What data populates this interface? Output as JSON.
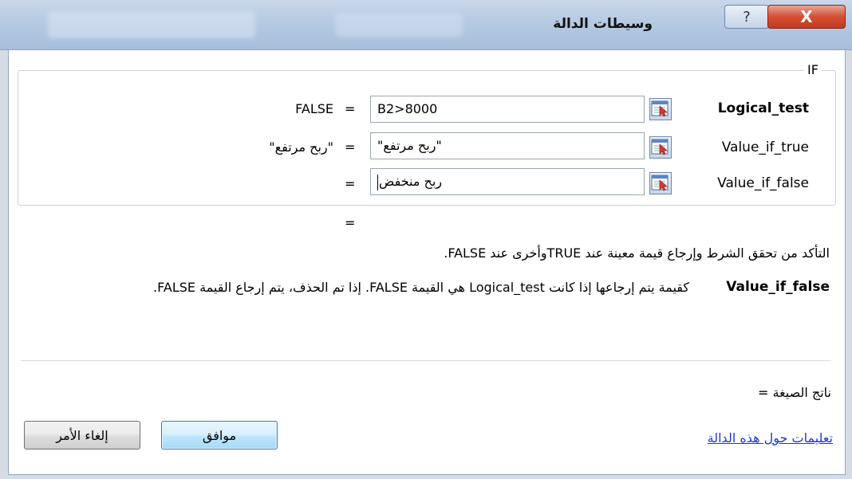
{
  "window": {
    "title": "وسيطات الدالة",
    "help_glyph": "?",
    "close_glyph": "X"
  },
  "function_name": "IF",
  "args": [
    {
      "name": "Logical_test",
      "value": "B2>8000",
      "eq": "=",
      "result": "FALSE"
    },
    {
      "name": "Value_if_true",
      "value": "\"ربح مرتفع\"",
      "eq": "=",
      "result": "\"ربح مرتفع\""
    },
    {
      "name": "Value_if_false",
      "value": "ربح منخفض",
      "eq": "=",
      "result": ""
    }
  ],
  "function_result_eq": "=",
  "description": "التأكد من تحقق الشرط وإرجاع قيمة معينة عند TRUEوأخرى عند FALSE.",
  "current_arg": {
    "name": "Value_if_false",
    "description": "كقيمة يتم إرجاعها إذا كانت Logical_test هي القيمة FALSE. إذا تم الحذف، يتم إرجاع القيمة FALSE."
  },
  "formula_result_label": "ناتج الصيغة =",
  "help_link": "تعليمات حول هذه الدالة",
  "buttons": {
    "ok": "موافق",
    "cancel": "إلغاء الأمر"
  },
  "icons": [
    "help-icon",
    "close-icon",
    "collapse-dialog-icon"
  ]
}
